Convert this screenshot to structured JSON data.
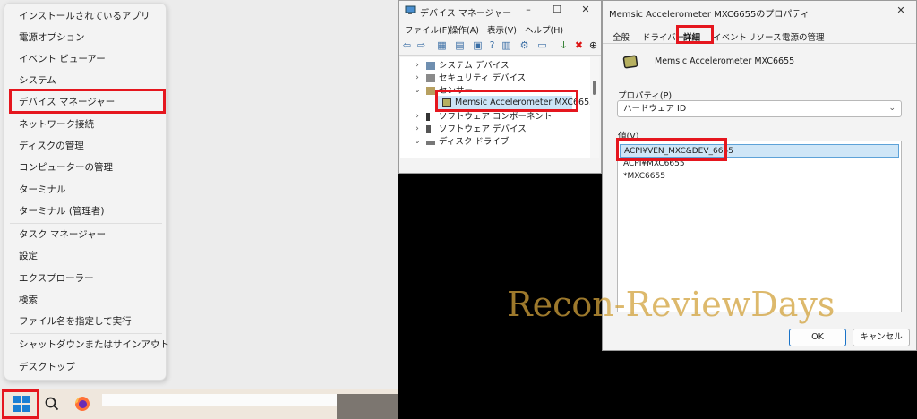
{
  "start_menu": {
    "items": [
      {
        "label": "インストールされているアプリ"
      },
      {
        "label": "電源オプション"
      },
      {
        "label": "イベント ビューアー"
      },
      {
        "label": "システム"
      },
      {
        "label": "デバイス マネージャー"
      },
      {
        "label": "ネットワーク接続"
      },
      {
        "label": "ディスクの管理"
      },
      {
        "label": "コンピューターの管理"
      },
      {
        "label": "ターミナル"
      },
      {
        "label": "ターミナル (管理者)"
      },
      {
        "label": "タスク マネージャー"
      },
      {
        "label": "設定"
      },
      {
        "label": "エクスプローラー"
      },
      {
        "label": "検索"
      },
      {
        "label": "ファイル名を指定して実行"
      },
      {
        "label": "シャットダウンまたはサインアウト"
      },
      {
        "label": "デスクトップ"
      }
    ],
    "submenu_arrow": "›"
  },
  "taskbar": {
    "icons": [
      "windows-start-icon",
      "search-icon",
      "firefox-icon"
    ]
  },
  "device_manager": {
    "title": "デバイス マネージャー",
    "menu": [
      "ファイル(F)",
      "操作(A)",
      "表示(V)",
      "ヘルプ(H)"
    ],
    "tree": [
      {
        "label": "システム デバイス",
        "expander": "›"
      },
      {
        "label": "セキュリティ デバイス",
        "expander": "›"
      },
      {
        "label": "センサー",
        "expander": "⌄"
      },
      {
        "label": "Memsic Accelerometer MXC6655",
        "expander": ""
      },
      {
        "label": "ソフトウェア コンポーネント",
        "expander": "›"
      },
      {
        "label": "ソフトウェア デバイス",
        "expander": "›"
      },
      {
        "label": "ディスク ドライブ",
        "expander": "⌄"
      }
    ]
  },
  "properties": {
    "title": "Memsic Accelerometer MXC6655のプロパティ",
    "tabs": [
      "全般",
      "ドライバー",
      "詳細",
      "イベント",
      "リソース",
      "電源の管理"
    ],
    "active_tab": "詳細",
    "device_name": "Memsic Accelerometer MXC6655",
    "property_label": "プロパティ(P)",
    "property_value": "ハードウェア ID",
    "value_label": "値(V)",
    "values": [
      "ACPI¥VEN_MXC&DEV_6655",
      "ACPI¥MXC6655",
      "*MXC6655"
    ],
    "ok_label": "OK",
    "cancel_label": "キャンセル"
  },
  "watermark": "Recon-ReviewDays",
  "colors": {
    "highlight": "#e5161e",
    "watermark": "#d2a23b",
    "selection": "#cfe6f7"
  }
}
